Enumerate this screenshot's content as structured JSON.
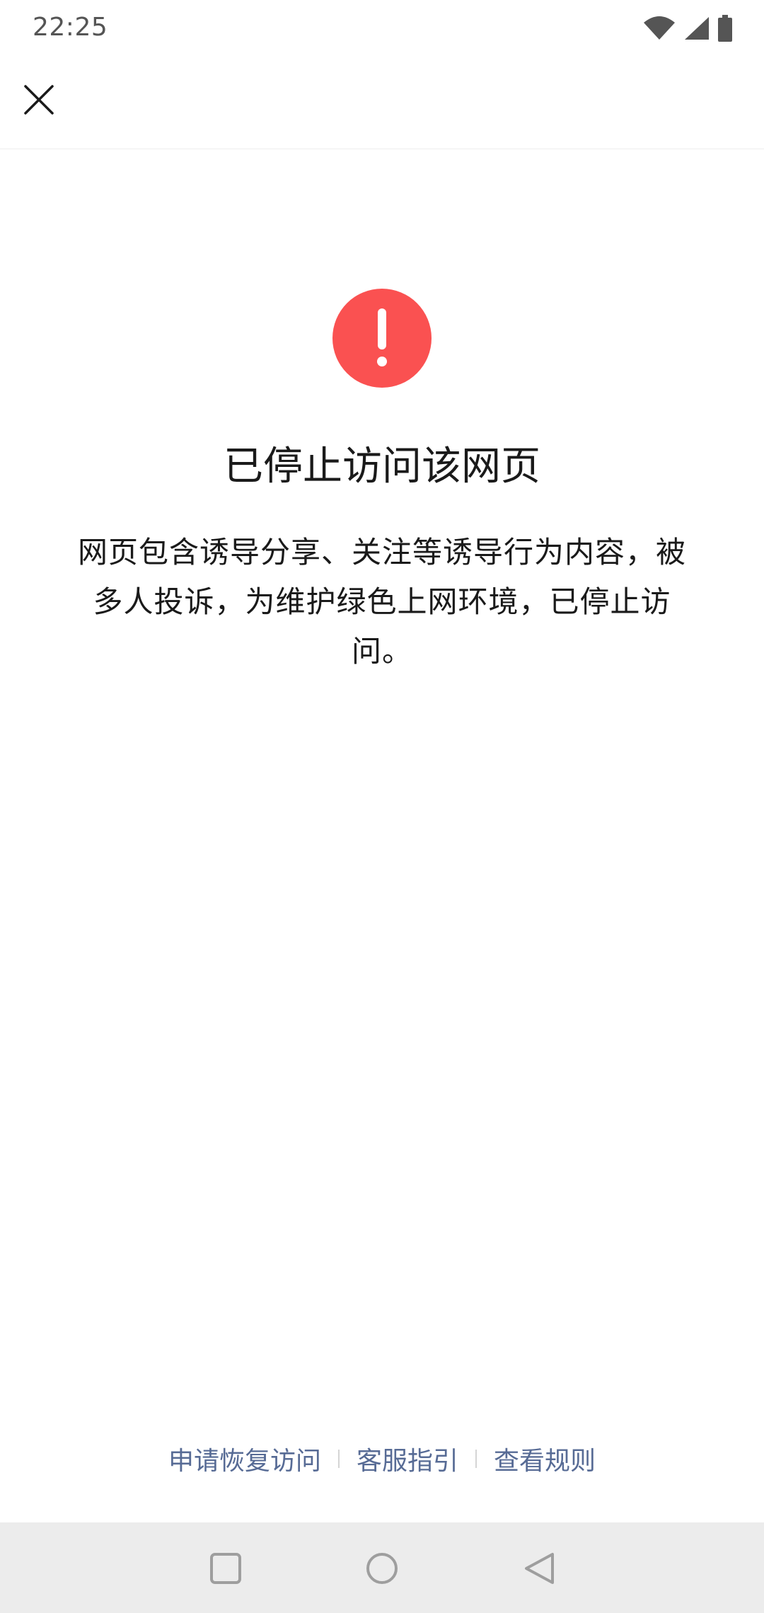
{
  "status_bar": {
    "time": "22:25",
    "icons": [
      "wifi-icon",
      "cellular-signal-icon",
      "battery-icon"
    ]
  },
  "top_bar": {
    "close_icon": "close-icon"
  },
  "notice": {
    "icon": "exclamation-circle-icon",
    "icon_color": "#fa5151",
    "title": "已停止访问该网页",
    "description": "网页包含诱导分享、关注等诱导行为内容，被多人投诉，为维护绿色上网环境，已停止访问。"
  },
  "footer": {
    "links": [
      {
        "label": "申请恢复访问"
      },
      {
        "label": "客服指引"
      },
      {
        "label": "查看规则"
      }
    ],
    "link_color": "#576b95"
  },
  "nav_bar": {
    "buttons": [
      "recents-square-icon",
      "home-circle-icon",
      "back-triangle-icon"
    ]
  }
}
